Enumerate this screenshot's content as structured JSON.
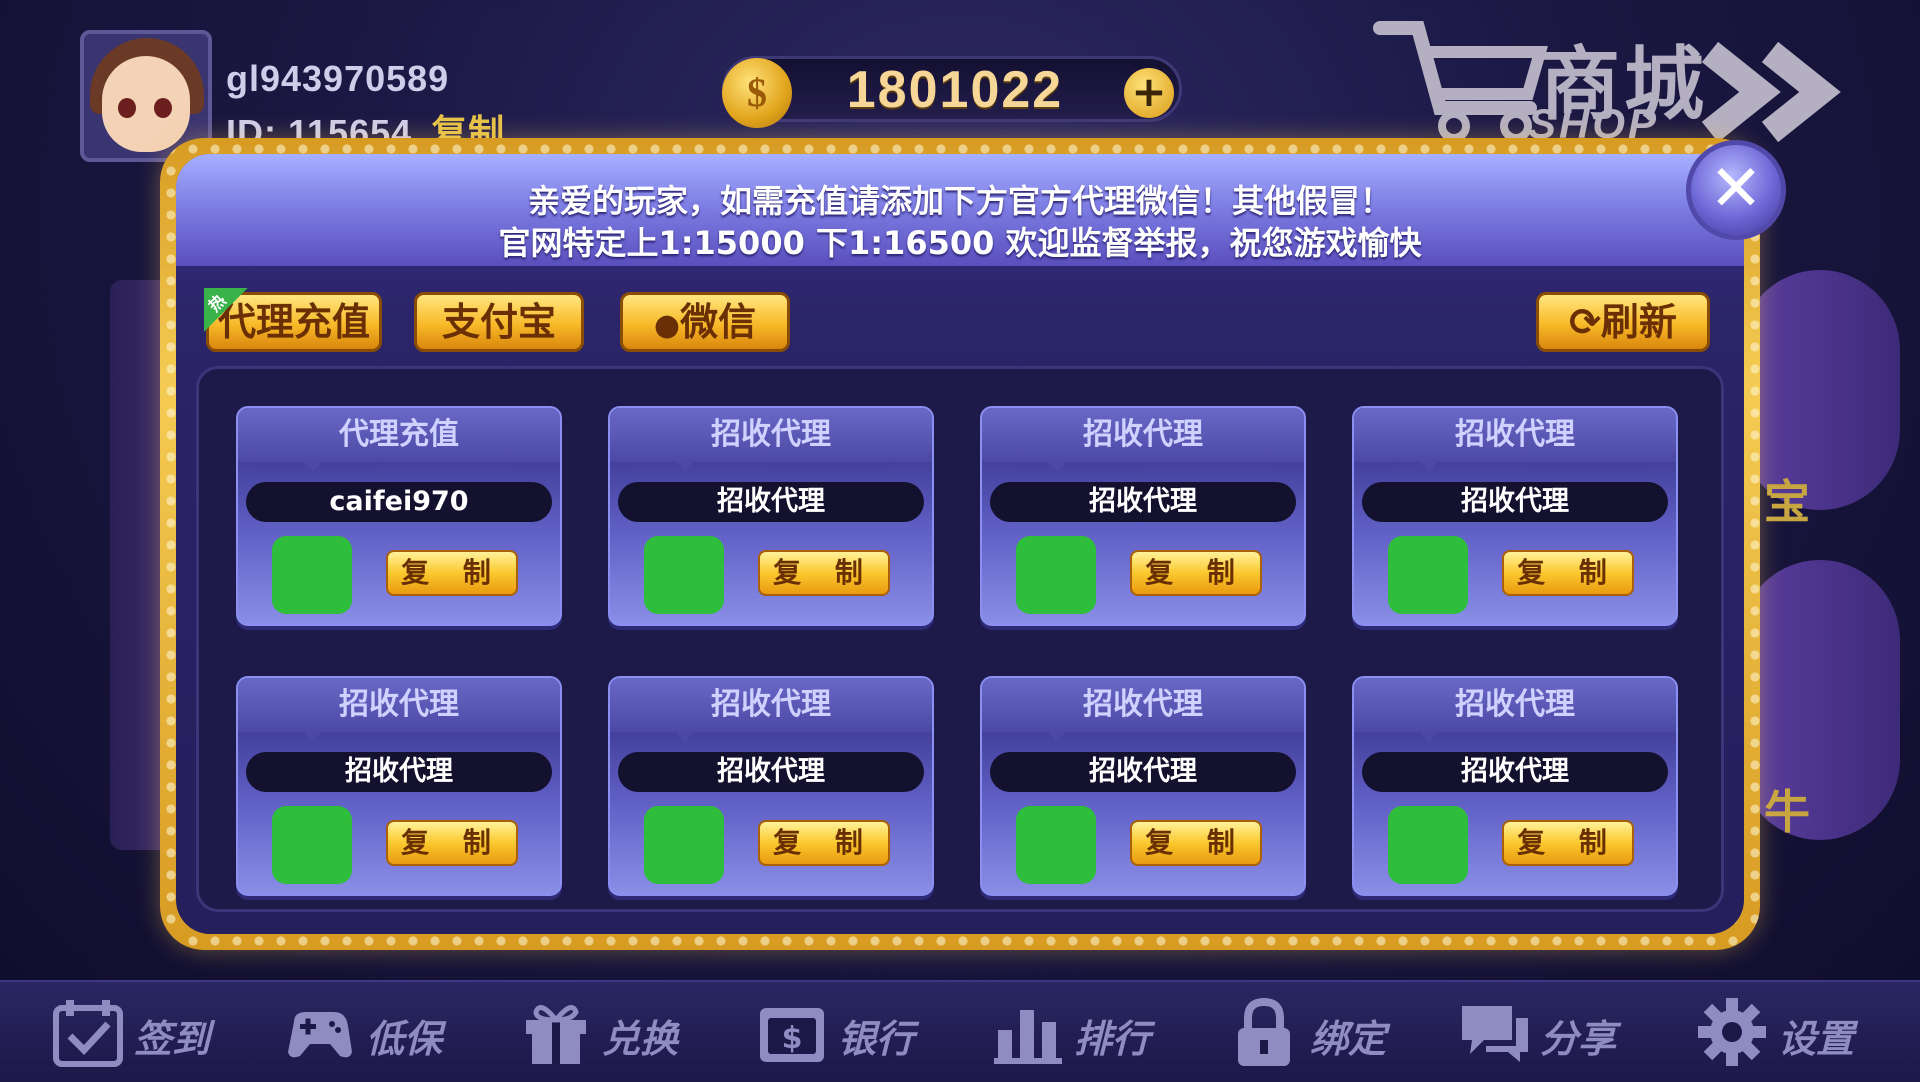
{
  "user": {
    "name": "gl943970589",
    "id_text": "ID: 115654",
    "copy_label": "复制"
  },
  "coins": {
    "value": "1801022",
    "coin_symbol": "$",
    "add_symbol": "+"
  },
  "shop": {
    "title_cn": "商城",
    "title_en": "SHOP"
  },
  "side": {
    "right_1": "宝",
    "right_2": "牛"
  },
  "modal": {
    "notice_line1": "亲爱的玩家，如需充值请添加下方官方代理微信！其他假冒！",
    "notice_line2": "官网特定上1:15000 下1:16500 欢迎监督举报，祝您游戏愉快",
    "close_symbol": "✕",
    "hot_badge": "热",
    "tabs": {
      "agent": "代理充值",
      "alipay": "支付宝",
      "wechat": "微信"
    },
    "refresh_label": "刷新",
    "cards": [
      {
        "title": "代理充值",
        "account": "caifei970",
        "copy": "复 制"
      },
      {
        "title": "招收代理",
        "account": "招收代理",
        "copy": "复 制"
      },
      {
        "title": "招收代理",
        "account": "招收代理",
        "copy": "复 制"
      },
      {
        "title": "招收代理",
        "account": "招收代理",
        "copy": "复 制"
      },
      {
        "title": "招收代理",
        "account": "招收代理",
        "copy": "复 制"
      },
      {
        "title": "招收代理",
        "account": "招收代理",
        "copy": "复 制"
      },
      {
        "title": "招收代理",
        "account": "招收代理",
        "copy": "复 制"
      },
      {
        "title": "招收代理",
        "account": "招收代理",
        "copy": "复 制"
      }
    ]
  },
  "bottom_nav": [
    {
      "label": "签到",
      "icon": "calendar-check-icon"
    },
    {
      "label": "低保",
      "icon": "gamepad-icon"
    },
    {
      "label": "兑换",
      "icon": "gift-icon"
    },
    {
      "label": "银行",
      "icon": "bank-icon"
    },
    {
      "label": "排行",
      "icon": "ranking-icon"
    },
    {
      "label": "绑定",
      "icon": "lock-icon"
    },
    {
      "label": "分享",
      "icon": "chat-bubble-icon"
    },
    {
      "label": "设置",
      "icon": "gear-icon"
    }
  ]
}
